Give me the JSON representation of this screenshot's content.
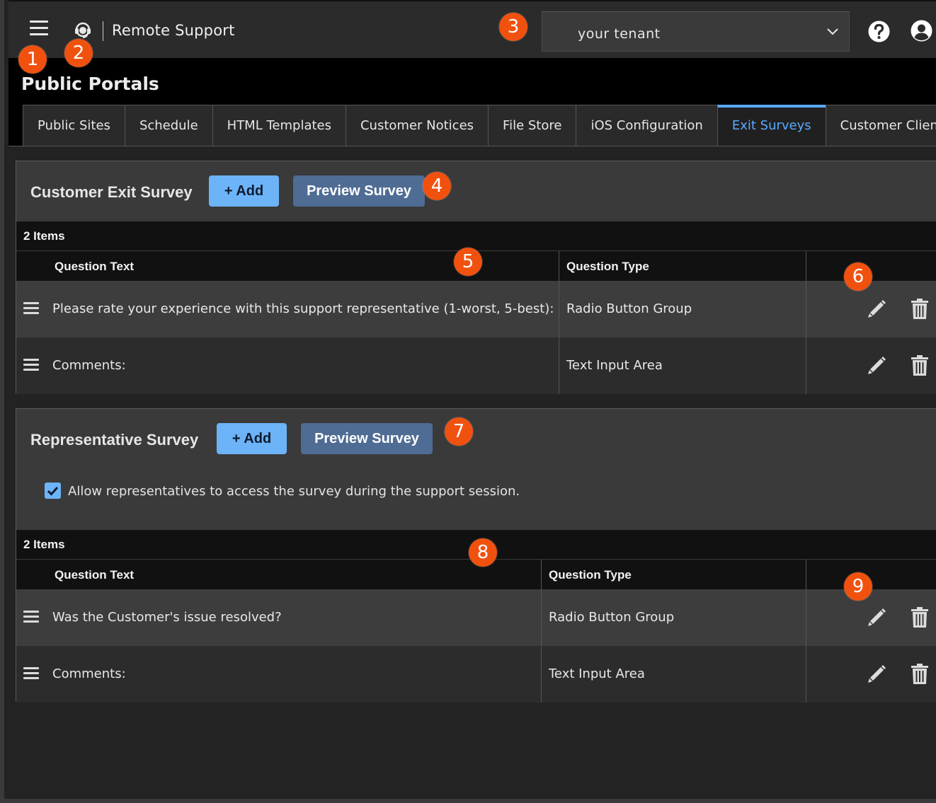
{
  "app": {
    "title": "Remote Support",
    "tenant_value": "your tenant"
  },
  "page": {
    "title": "Public Portals"
  },
  "tabs": [
    {
      "label": "Public Sites"
    },
    {
      "label": "Schedule"
    },
    {
      "label": "HTML Templates"
    },
    {
      "label": "Customer Notices"
    },
    {
      "label": "File Store"
    },
    {
      "label": "iOS Configuration"
    },
    {
      "label": "Exit Surveys",
      "active": true
    },
    {
      "label": "Customer Client"
    }
  ],
  "customer_survey": {
    "title": "Customer Exit Survey",
    "add_label": "+ Add",
    "preview_label": "Preview Survey",
    "items_count": "2 Items",
    "col_question": "Question Text",
    "col_type": "Question Type",
    "rows": [
      {
        "text": "Please rate your experience with this support representative (1-worst, 5-best):",
        "type": "Radio Button Group"
      },
      {
        "text": "Comments:",
        "type": "Text Input Area"
      }
    ]
  },
  "rep_survey": {
    "title": "Representative Survey",
    "add_label": "+ Add",
    "preview_label": "Preview Survey",
    "checkbox_label": "Allow representatives to access the survey during the support session.",
    "checkbox_checked": true,
    "items_count": "2 Items",
    "col_question": "Question Text",
    "col_type": "Question Type",
    "rows": [
      {
        "text": "Was the Customer's issue resolved?",
        "type": "Radio Button Group"
      },
      {
        "text": "Comments:",
        "type": "Text Input Area"
      }
    ]
  },
  "callouts": [
    "1",
    "2",
    "3",
    "4",
    "5",
    "6",
    "7",
    "8",
    "9"
  ],
  "colors": {
    "accent": "#5aa9ff",
    "add_button": "#6db3f8",
    "preview_button": "#4f6c94",
    "callout": "#f1510f"
  }
}
